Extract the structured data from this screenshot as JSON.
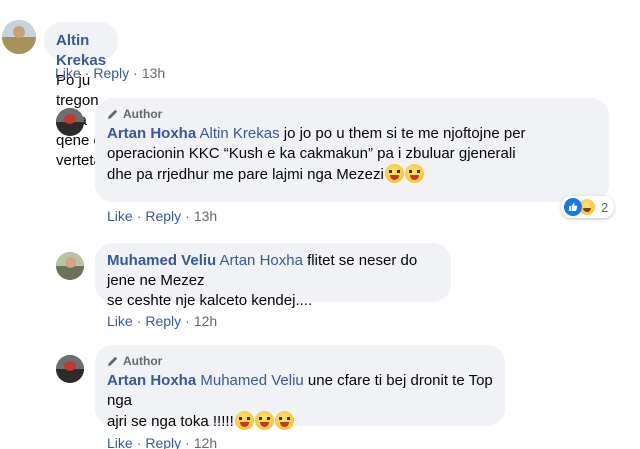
{
  "comments": [
    {
      "name": "Altin Krekas",
      "text": "Po ju tregon si ka qene e verteta",
      "actions": {
        "like": "Like",
        "reply": "Reply",
        "time": "13h"
      }
    },
    {
      "author_label": "Author",
      "name": "Artan Hoxha",
      "mention": "Altin Krekas",
      "text_line1": " jo jo po u them si te me njoftojne per",
      "text_line2": "operacionin KKC “Kush e ka cakmakun” pa i zbuluar gjenerali",
      "text_line3": "dhe pa rrjedhur me pare lajmi nga Mezezi",
      "reaction_count": "2",
      "actions": {
        "like": "Like",
        "reply": "Reply",
        "time": "13h"
      }
    },
    {
      "name": "Muhamed Veliu",
      "mention": "Artan Hoxha",
      "text_line1": " flitet se neser do jene ne Mezez",
      "text_line2": "se ceshte nje kalceto kendej....",
      "actions": {
        "like": "Like",
        "reply": "Reply",
        "time": "12h"
      }
    },
    {
      "author_label": "Author",
      "name": "Artan Hoxha",
      "mention": "Muhamed Veliu",
      "text_line1": " une cfare ti bej dronit te Top nga",
      "text_line2": "ajri se nga toka !!!!!",
      "actions": {
        "like": "Like",
        "reply": "Reply",
        "time": "12h"
      }
    }
  ],
  "icons": {
    "pencil": "pencil-icon",
    "emoji": "grinning-tongue-emoji",
    "like_reaction": "like-reaction-icon",
    "haha_reaction": "haha-reaction-icon"
  },
  "colors": {
    "name": "#385898",
    "bubble": "#f0f2f5",
    "meta": "#65676b",
    "like_blue": "#1877f2"
  }
}
